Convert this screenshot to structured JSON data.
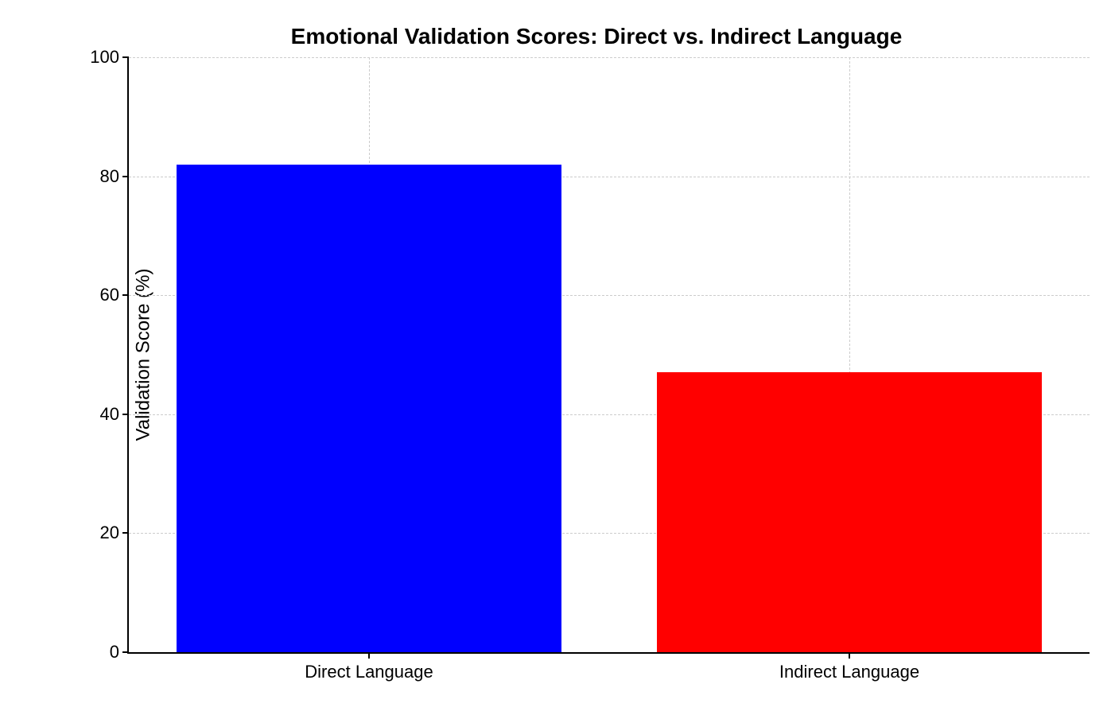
{
  "chart_data": {
    "type": "bar",
    "title": "Emotional Validation Scores: Direct vs. Indirect Language",
    "categories": [
      "Direct Language",
      "Indirect Language"
    ],
    "values": [
      82,
      47
    ],
    "colors": [
      "#0000ff",
      "#ff0000"
    ],
    "xlabel": "",
    "ylabel": "Validation Score (%)",
    "ylim": [
      0,
      100
    ],
    "yticks": [
      0,
      20,
      40,
      60,
      80,
      100
    ],
    "grid": true
  }
}
